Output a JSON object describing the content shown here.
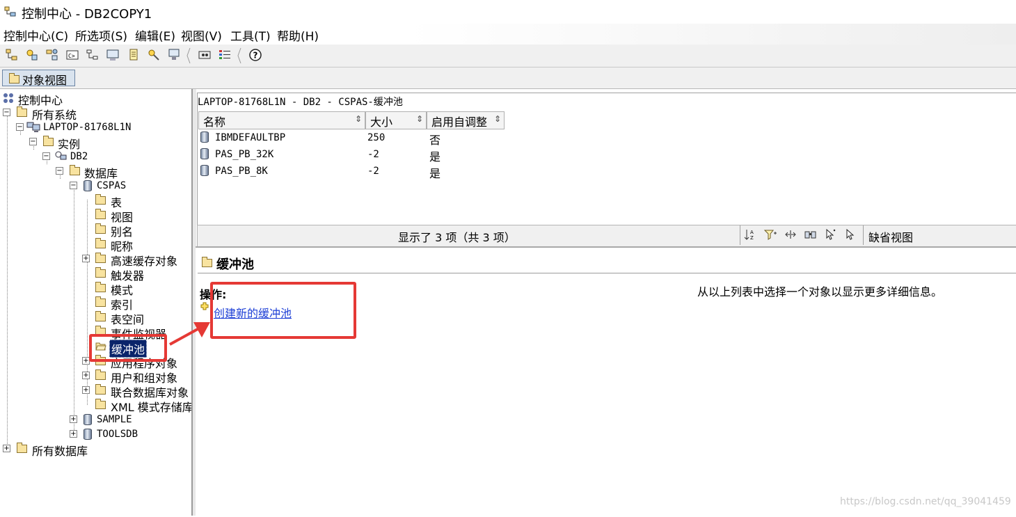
{
  "window": {
    "title": "控制中心 - DB2COPY1"
  },
  "menu": [
    "控制中心(C)",
    "所选项(S)",
    "编辑(E)",
    "视图(V)",
    "工具(T)",
    "帮助(H)"
  ],
  "toolbar": {
    "icons": [
      "object-tree-icon",
      "replication-center-icon",
      "satellite-admin-icon",
      "command-editor-icon",
      "task-center-icon",
      "health-center-icon",
      "journal-icon",
      "license-center-icon",
      "configuration-assistant-icon",
      "tools-settings-icon",
      "legend-icon",
      "help-icon"
    ]
  },
  "view_tab": {
    "label": "对象视图"
  },
  "tree": {
    "root": "控制中心",
    "all_systems": "所有系统",
    "host": "LAPTOP-81768L1N",
    "instance_folder": "实例",
    "instance": "DB2",
    "databases_folder": "数据库",
    "database": "CSPAS",
    "db_children": [
      "表",
      "视图",
      "别名",
      "昵称",
      "高速缓存对象",
      "触发器",
      "模式",
      "索引",
      "表空间",
      "事件监视器",
      "缓冲池",
      "应用程序对象",
      "用户和组对象",
      "联合数据库对象",
      "XML 模式存储库"
    ],
    "other_databases": [
      "SAMPLE",
      "TOOLSDB"
    ],
    "all_databases": "所有数据库",
    "selected": "缓冲池"
  },
  "contents": {
    "path": "LAPTOP-81768L1N - DB2 - CSPAS-缓冲池",
    "columns": [
      "名称",
      "大小",
      "启用自调整"
    ],
    "rows": [
      {
        "name": "IBMDEFAULTBP",
        "size": "250",
        "auto": "否"
      },
      {
        "name": "PAS_PB_32K",
        "size": "-2",
        "auto": "是"
      },
      {
        "name": "PAS_PB_8K",
        "size": "-2",
        "auto": "是"
      }
    ],
    "status": "显示了 3 项（共 3 项）",
    "default_view": "缺省视图"
  },
  "details": {
    "title": "缓冲池",
    "actions_label": "操作:",
    "create_link": "创建新的缓冲池",
    "hint": "从以上列表中选择一个对象以显示更多详细信息。"
  },
  "watermark": "https://blog.csdn.net/qq_39041459",
  "colors": {
    "annotation_red": "#e53935",
    "selection_blue": "#0a246a",
    "link_blue": "#1d3fd6"
  }
}
